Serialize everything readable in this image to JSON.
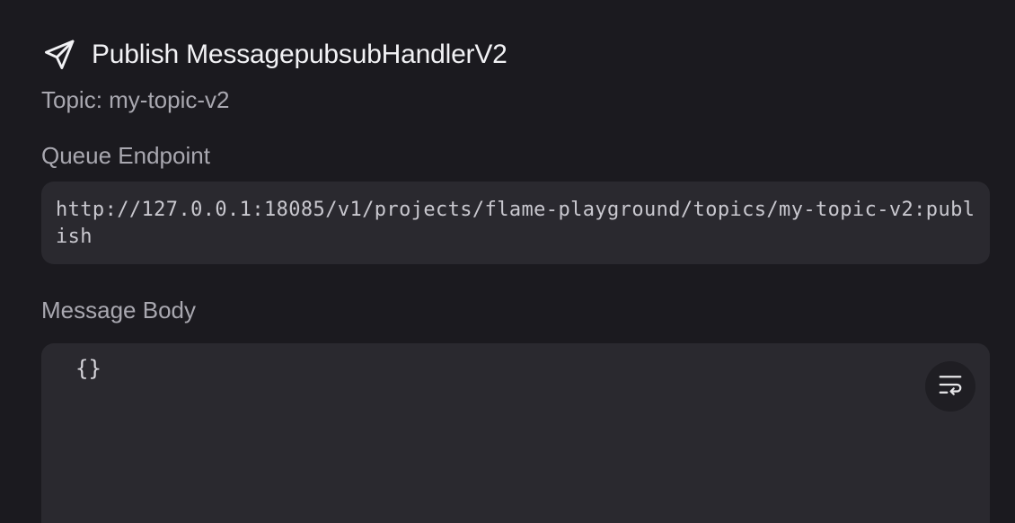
{
  "header": {
    "icon": "send-icon",
    "title": "Publish MessagepubsubHandlerV2"
  },
  "topic": {
    "text": "Topic: my-topic-v2"
  },
  "queue_endpoint": {
    "label": "Queue Endpoint",
    "value": "http://127.0.0.1:18085/v1/projects/flame-playground/topics/my-topic-v2:publish"
  },
  "message_body": {
    "label": "Message Body",
    "value": "{}",
    "wrap_toggle_icon": "wrap-text-icon"
  },
  "colors": {
    "background": "#1b1a1f",
    "surface": "#2a292f",
    "muted_text": "#a9a8b0"
  }
}
